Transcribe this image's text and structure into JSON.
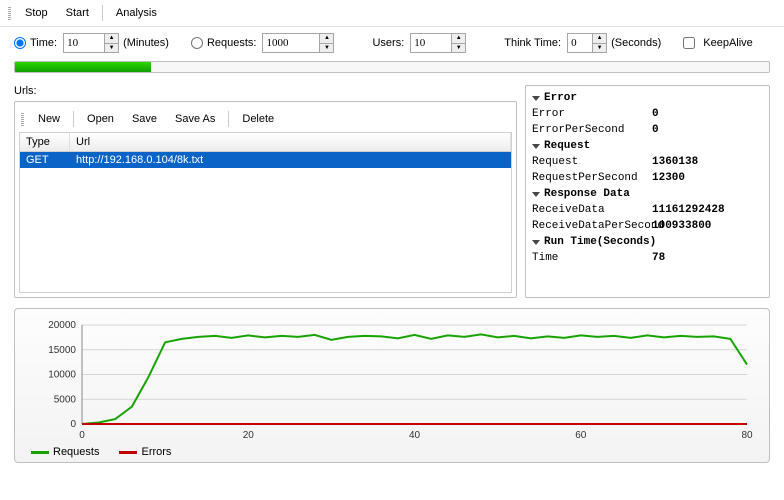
{
  "toolbar": {
    "stop": "Stop",
    "start": "Start",
    "analysis": "Analysis"
  },
  "config": {
    "time_label": "Time:",
    "time_value": "10",
    "time_unit": "(Minutes)",
    "requests_label": "Requests:",
    "requests_value": "1000",
    "users_label": "Users:",
    "users_value": "10",
    "think_label": "Think Time:",
    "think_value": "0",
    "think_unit": "(Seconds)",
    "keepalive_label": "KeepAlive"
  },
  "urls": {
    "section_label": "Urls:",
    "new": "New",
    "open": "Open",
    "save": "Save",
    "saveas": "Save As",
    "delete": "Delete",
    "col_type": "Type",
    "col_url": "Url",
    "rows": [
      {
        "type": "GET",
        "url": "http://192.168.0.104/8k.txt"
      }
    ]
  },
  "stats": {
    "error_head": "Error",
    "error_label": "Error",
    "error_val": "0",
    "eps_label": "ErrorPerSecond",
    "eps_val": "0",
    "request_head": "Request",
    "request_label": "Request",
    "request_val": "1360138",
    "rps_label": "RequestPerSecond",
    "rps_val": "12300",
    "resp_head": "Response Data",
    "recv_label": "ReceiveData",
    "recv_val": "11161292428",
    "recvps_label": "ReceiveDataPerSecond",
    "recvps_val": "100933800",
    "run_head": "Run Time(Seconds)",
    "time_label": "Time",
    "time_val": "78"
  },
  "legend": {
    "requests": "Requests",
    "errors": "Errors"
  },
  "chart_data": {
    "type": "line",
    "title": "",
    "xlabel": "",
    "ylabel": "",
    "xlim": [
      0,
      80
    ],
    "ylim": [
      0,
      20000
    ],
    "xticks": [
      0,
      20,
      40,
      60,
      80
    ],
    "yticks": [
      0,
      5000,
      10000,
      15000,
      20000
    ],
    "series": [
      {
        "name": "Requests",
        "color": "#18a400",
        "x": [
          0,
          2,
          4,
          6,
          8,
          10,
          12,
          14,
          16,
          18,
          20,
          22,
          24,
          26,
          28,
          30,
          32,
          34,
          36,
          38,
          40,
          42,
          44,
          46,
          48,
          50,
          52,
          54,
          56,
          58,
          60,
          62,
          64,
          66,
          68,
          70,
          72,
          74,
          76,
          78,
          80
        ],
        "y": [
          0,
          300,
          1000,
          3500,
          9500,
          16500,
          17200,
          17600,
          17800,
          17400,
          17900,
          17500,
          17800,
          17600,
          18000,
          17000,
          17600,
          17800,
          17700,
          17300,
          18000,
          17200,
          17900,
          17600,
          18100,
          17500,
          17800,
          17300,
          17700,
          17400,
          17900,
          17600,
          17800,
          17400,
          17900,
          17500,
          17800,
          17600,
          17700,
          17200,
          12000
        ]
      },
      {
        "name": "Errors",
        "color": "#c20000",
        "x": [
          0,
          80
        ],
        "y": [
          0,
          0
        ]
      }
    ]
  }
}
